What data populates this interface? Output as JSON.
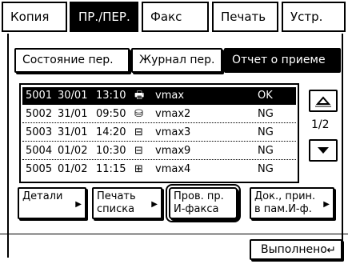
{
  "tabs": [
    {
      "label": "Копия",
      "active": false
    },
    {
      "label": "ПР./ПЕР.",
      "active": true
    },
    {
      "label": "Факс",
      "active": false
    },
    {
      "label": "Печать",
      "active": false
    },
    {
      "label": "Устр.",
      "active": false
    }
  ],
  "subtabs": [
    {
      "label": "Состояние пер.",
      "active": false
    },
    {
      "label": "Журнал пер.",
      "active": false
    },
    {
      "label": "Отчет о приеме",
      "active": true
    }
  ],
  "list": {
    "rows": [
      {
        "id": "5001",
        "date": "30/01",
        "time": "13:10",
        "icon": "printer-icon",
        "glyph": "🖶",
        "name": "vmax",
        "status": "OK",
        "selected": true
      },
      {
        "id": "5002",
        "date": "31/01",
        "time": "09:50",
        "icon": "network-icon",
        "glyph": "⛁",
        "name": "vmax2",
        "status": "NG",
        "selected": false
      },
      {
        "id": "5003",
        "date": "31/01",
        "time": "14:20",
        "icon": "inbox-icon",
        "glyph": "⊟",
        "name": "vmax3",
        "status": "NG",
        "selected": false
      },
      {
        "id": "5004",
        "date": "01/02",
        "time": "10:30",
        "icon": "inbox-icon",
        "glyph": "⊟",
        "name": "vmax9",
        "status": "NG",
        "selected": false
      },
      {
        "id": "5005",
        "date": "01/02",
        "time": "11:15",
        "icon": "memory-box-icon",
        "glyph": "⊞",
        "name": "vmax4",
        "status": "NG",
        "selected": false
      }
    ]
  },
  "pagination": {
    "indicator": "1/2"
  },
  "actions": {
    "details": {
      "line1": "Детали",
      "line2": ""
    },
    "print_list": {
      "line1": "Печать",
      "line2": "списка"
    },
    "check_ifax": {
      "line1": "Пров. пр.",
      "line2": "И-факса"
    },
    "docs_in_memory": {
      "line1": "Док., прин.",
      "line2": "в пам.И-ф."
    }
  },
  "done_label": "Выполнено"
}
